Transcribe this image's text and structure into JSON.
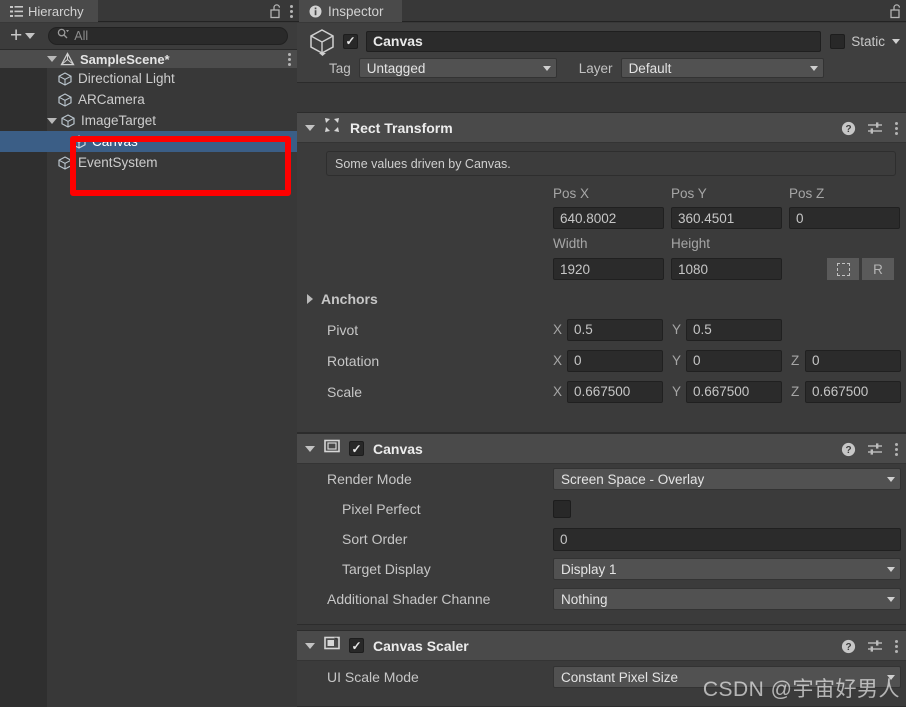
{
  "hierarchy": {
    "tab_label": "Hierarchy",
    "tab_icon": "hierarchy-icon",
    "lock_icon": "lock-open-icon",
    "menu_icon": "kebab-menu-icon",
    "toolbar": {
      "create_label": "+",
      "create_icon": "plus-icon",
      "dropdown_icon": "chevron-down-icon",
      "search_icon": "search-icon",
      "search_placeholder": "All",
      "search_value": ""
    },
    "scene": {
      "name": "SampleScene*",
      "icon": "unity-scene-icon",
      "menu_icon": "kebab-menu-icon"
    },
    "items": [
      {
        "label": "Directional Light",
        "icon": "gameobject-cube-icon",
        "indent": 2,
        "selected": false,
        "expandable": false
      },
      {
        "label": "ARCamera",
        "icon": "gameobject-cube-icon",
        "indent": 2,
        "selected": false,
        "expandable": false
      },
      {
        "label": "ImageTarget",
        "icon": "gameobject-cube-icon",
        "indent": 2,
        "selected": false,
        "expandable": true
      },
      {
        "label": "Canvas",
        "icon": "gameobject-cube-icon",
        "indent": 3,
        "selected": true,
        "expandable": false
      },
      {
        "label": "EventSystem",
        "icon": "gameobject-cube-icon",
        "indent": 2,
        "selected": false,
        "expandable": false
      }
    ]
  },
  "inspector": {
    "tab_label": "Inspector",
    "tab_icon": "info-circle-icon",
    "lock_icon": "lock-open-icon",
    "gameobject": {
      "prefab_icon": "gameobject-cube-icon",
      "enabled": true,
      "name": "Canvas",
      "static_label": "Static",
      "static_checked": false,
      "tag_label": "Tag",
      "tag_value": "Untagged",
      "layer_label": "Layer",
      "layer_value": "Default"
    },
    "components": [
      {
        "title": "Rect Transform",
        "icon": "rect-transform-icon",
        "has_checkbox": false,
        "help_icon": "help-icon",
        "preset_icon": "preset-settings-icon",
        "menu_icon": "kebab-menu-icon",
        "helpbox": "Some values driven by Canvas.",
        "pos_headers": [
          "Pos X",
          "Pos Y",
          "Pos Z"
        ],
        "pos_values": [
          "640.8002",
          "360.4501",
          "0"
        ],
        "size_headers": [
          "Width",
          "Height"
        ],
        "size_values": [
          "1920",
          "1080"
        ],
        "blueprint_icon": "blueprint-mode-icon",
        "raw_label": "R",
        "anchors_label": "Anchors",
        "pivot_label": "Pivot",
        "pivot_axes": [
          "X",
          "Y"
        ],
        "pivot_values": [
          "0.5",
          "0.5"
        ],
        "rotation_label": "Rotation",
        "rotation_axes": [
          "X",
          "Y",
          "Z"
        ],
        "rotation_values": [
          "0",
          "0",
          "0"
        ],
        "scale_label": "Scale",
        "scale_axes": [
          "X",
          "Y",
          "Z"
        ],
        "scale_values": [
          "0.667500",
          "0.667500",
          "0.667500"
        ]
      },
      {
        "title": "Canvas",
        "icon": "canvas-icon",
        "has_checkbox": true,
        "enabled": true,
        "rows": [
          {
            "label": "Render Mode",
            "value": "Screen Space - Overlay",
            "type": "dropdown"
          },
          {
            "label": "Pixel Perfect",
            "value": "",
            "type": "checkbox",
            "checked": false
          },
          {
            "label": "Sort Order",
            "value": "0",
            "type": "number"
          },
          {
            "label": "Target Display",
            "value": "Display 1",
            "type": "dropdown"
          },
          {
            "label": "Additional Shader Channe",
            "value": "Nothing",
            "type": "dropdown"
          }
        ]
      },
      {
        "title": "Canvas Scaler",
        "icon": "canvas-scaler-icon",
        "has_checkbox": true,
        "enabled": true,
        "rows": [
          {
            "label": "UI Scale Mode",
            "value": "Constant Pixel Size",
            "type": "dropdown"
          }
        ]
      }
    ]
  },
  "watermark": {
    "prefix": "CSDN @",
    "author": "宇宙好男人"
  },
  "annotation": {
    "type": "red-rectangle-highlight",
    "color": "#fe0000"
  }
}
